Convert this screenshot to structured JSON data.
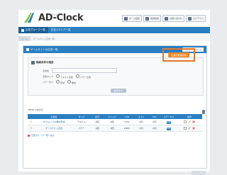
{
  "app": {
    "logo_text": "AD-Clock",
    "logo_sub": "アドクロック"
  },
  "header": {
    "buttons": [
      {
        "label": "ホーム設定",
        "icon": "config-icon"
      },
      {
        "label": "会員情報",
        "icon": "user-icon"
      },
      {
        "label": "お問い合わせ",
        "icon": "search-icon"
      },
      {
        "label": "ログアウト",
        "icon": "logout-icon"
      }
    ]
  },
  "nav": {
    "items": [
      {
        "label": "広告グループ一覧",
        "active": true
      },
      {
        "label": "広告メディア一覧",
        "active": false
      }
    ]
  },
  "breadcrumb": {
    "home": "ホーム",
    "current": "ゲームサイト広告一覧"
  },
  "panel": {
    "title": "ゲームサイトの広告一覧",
    "top_right_button": "CSVダウンロード",
    "search": {
      "title": "検索条件の指定",
      "fields": [
        {
          "label": "広告名",
          "value": "",
          "type": "input"
        },
        {
          "label": "広告タイプ",
          "options": [
            "テキスト広告",
            "バナー広告"
          ],
          "type": "radio"
        },
        {
          "label": "ステータス",
          "options": [
            "有効",
            "無効"
          ],
          "type": "radio"
        }
      ],
      "button_label": "検索する"
    },
    "count_text": "2件中1-2件表示",
    "add_button": "広告の新規作成",
    "table": {
      "headers": [
        "",
        "広告名",
        "タイプ",
        "表示",
        "クリック",
        "CTR",
        "コスト",
        "CPC",
        "ステータス",
        "操作"
      ],
      "rows": [
        {
          "name": "ADクロックの無料登録",
          "type": "テキスト",
          "impr": "4回",
          "click": "2回",
          "ctr": "50%",
          "cost": "0円",
          "cpc": "0円",
          "status": "有効"
        },
        {
          "name": "ゲームサイト広告",
          "type": "バナー",
          "impr": "1回",
          "click": "1回",
          "ctr": "100%",
          "cost": "0円",
          "cpc": "0円",
          "status": "有効"
        }
      ]
    },
    "back_link": "広告グループ一覧へ戻る"
  },
  "colors": {
    "accent": "#2a7fc1",
    "highlight": "#e8772e",
    "add_button": "#ef8a2a"
  }
}
